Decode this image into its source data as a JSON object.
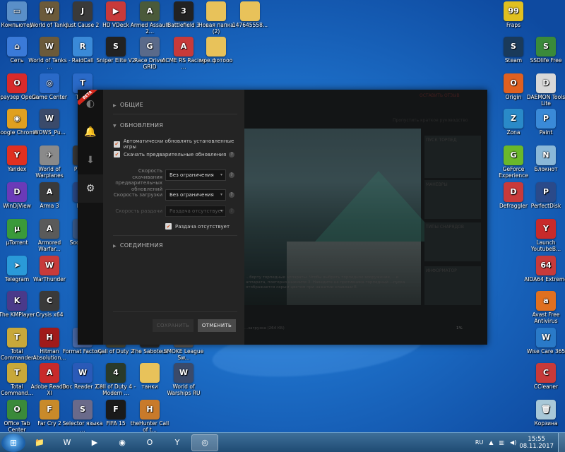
{
  "desktop": {
    "icons_left": [
      {
        "label": "Компьютер",
        "icon": "computer-icon",
        "color": "#5a8fc8",
        "glyph": "▭"
      },
      {
        "label": "World of Tanks",
        "icon": "world-of-tanks-icon",
        "color": "#6b5a3a",
        "glyph": "W"
      },
      {
        "label": "Just Cause 2",
        "icon": "just-cause-icon",
        "color": "#3a3a3a",
        "glyph": "J"
      },
      {
        "label": "HD VDeck",
        "icon": "hd-vdeck-icon",
        "color": "#c83a3a",
        "glyph": "▶"
      },
      {
        "label": "Armed Assault 2...",
        "icon": "armed-assault-icon",
        "color": "#4a5a3a",
        "glyph": "A"
      },
      {
        "label": "Battlefield 3",
        "icon": "battlefield-icon",
        "color": "#222",
        "glyph": "3"
      },
      {
        "label": "Новая папка (2)",
        "icon": "folder-icon",
        "color": "#e8c25a",
        "glyph": ""
      },
      {
        "label": "147645558...",
        "icon": "folder-icon",
        "color": "#e8c25a",
        "glyph": ""
      },
      {
        "label": "Сеть",
        "icon": "network-icon",
        "color": "#3a7ad8",
        "glyph": "⌂"
      },
      {
        "label": "World of Tanks - ...",
        "icon": "world-of-tanks-icon",
        "color": "#6b5a3a",
        "glyph": "W"
      },
      {
        "label": "RaidCall",
        "icon": "raidcall-icon",
        "color": "#3a8ad8",
        "glyph": "R"
      },
      {
        "label": "Sniper Elite V2",
        "icon": "sniper-elite-icon",
        "color": "#222",
        "glyph": "S"
      },
      {
        "label": "Race Driver GRID",
        "icon": "grid-icon",
        "color": "#5a6a8a",
        "glyph": "G"
      },
      {
        "label": "ACME RS Racing ...",
        "icon": "acme-icon",
        "color": "#c83a3a",
        "glyph": "A"
      },
      {
        "label": "мое.фотооо",
        "icon": "folder-icon",
        "color": "#e8c25a",
        "glyph": ""
      },
      {
        "label": "Браузер Opera",
        "icon": "opera-icon",
        "color": "#d82a2a",
        "glyph": "O"
      },
      {
        "label": "Game Center",
        "icon": "game-center-icon",
        "color": "#2a6ac8",
        "glyph": "◎"
      },
      {
        "label": "Team",
        "icon": "team-icon",
        "color": "#2a6ac8",
        "glyph": "T"
      },
      {
        "label": "Google Chrome",
        "icon": "chrome-icon",
        "color": "#e0a020",
        "glyph": "◉"
      },
      {
        "label": "WOWS_Pu...",
        "icon": "wows-icon",
        "color": "#3a4a6a",
        "glyph": "W"
      },
      {
        "label": "Yandex",
        "icon": "yandex-icon",
        "color": "#e03020",
        "glyph": "Y"
      },
      {
        "label": "World of Warplanes",
        "icon": "world-of-warplanes-icon",
        "color": "#8a8a8a",
        "glyph": "✈"
      },
      {
        "label": "PLANE",
        "icon": "plane-icon",
        "color": "#3a3a3a",
        "glyph": "P"
      },
      {
        "label": "WinDjView",
        "icon": "windjview-icon",
        "color": "#6a3ab8",
        "glyph": "D"
      },
      {
        "label": "Arma 3",
        "icon": "arma-icon",
        "color": "#3a3a3a",
        "glyph": "A"
      },
      {
        "label": "Blue",
        "icon": "blue-icon",
        "color": "#2a4a8a",
        "glyph": "B"
      },
      {
        "label": "µTorrent",
        "icon": "utorrent-icon",
        "color": "#3a9a3a",
        "glyph": "µ"
      },
      {
        "label": "Armored Warfar...",
        "icon": "armored-warfare-icon",
        "color": "#5a5a5a",
        "glyph": "A"
      },
      {
        "label": "Soci Lat...",
        "icon": "soci-icon",
        "color": "#3a5a8a",
        "glyph": "S"
      },
      {
        "label": "Telegram",
        "icon": "telegram-icon",
        "color": "#2a9ad8",
        "glyph": "➤"
      },
      {
        "label": "WarThunder",
        "icon": "warthunder-icon",
        "color": "#c83a3a",
        "glyph": "W"
      },
      {
        "label": "The KMPlayer",
        "icon": "kmplayer-icon",
        "color": "#4a3a8a",
        "glyph": "K"
      },
      {
        "label": "Crysis x64",
        "icon": "crysis-icon",
        "color": "#3a3a3a",
        "glyph": "C"
      },
      {
        "label": "Total Commander",
        "icon": "total-commander-icon",
        "color": "#c8a83a",
        "glyph": "T"
      },
      {
        "label": "Hitman Absolution...",
        "icon": "hitman-icon",
        "color": "#a01a1a",
        "glyph": "H"
      },
      {
        "label": "Format Factory",
        "icon": "format-factory-icon",
        "color": "#4a6aa8",
        "glyph": "F"
      },
      {
        "label": "Call of Duty 2",
        "icon": "cod2-icon",
        "color": "#4a4a3a",
        "glyph": "2"
      },
      {
        "label": "The Saboteur",
        "icon": "saboteur-icon",
        "color": "#2a2a2a",
        "glyph": "S"
      },
      {
        "label": "SMOKE League Sw...",
        "icon": "smoke-icon",
        "color": "#5a5a5a",
        "glyph": "S"
      },
      {
        "label": "Total Command...",
        "icon": "total-commander-icon",
        "color": "#c8a83a",
        "glyph": "T"
      },
      {
        "label": "Adobe Reader XI",
        "icon": "adobe-reader-icon",
        "color": "#c82a2a",
        "glyph": "A"
      },
      {
        "label": "Doc Reader 2.0",
        "icon": "doc-reader-icon",
        "color": "#2a5ab8",
        "glyph": "W"
      },
      {
        "label": "Call of Duty 4 - Modern ...",
        "icon": "cod4-icon",
        "color": "#2a3a2a",
        "glyph": "4"
      },
      {
        "label": "танки",
        "icon": "folder-icon",
        "color": "#e8c25a",
        "glyph": ""
      },
      {
        "label": "World of Warships RU",
        "icon": "world-of-warships-icon",
        "color": "#3a4a6a",
        "glyph": "W"
      },
      {
        "label": "Office Tab Center",
        "icon": "office-tab-icon",
        "color": "#3a8a3a",
        "glyph": "O"
      },
      {
        "label": "Far Cry 2",
        "icon": "farcry-icon",
        "color": "#c88a2a",
        "glyph": "F"
      },
      {
        "label": "Selector языка ...",
        "icon": "selector-icon",
        "color": "#6a6a8a",
        "glyph": "S"
      },
      {
        "label": "FIFA 15",
        "icon": "fifa-icon",
        "color": "#1a1a1a",
        "glyph": "F"
      },
      {
        "label": "theHunter Call of t...",
        "icon": "thehunter-icon",
        "color": "#c87a2a",
        "glyph": "H"
      }
    ],
    "icons_right": [
      {
        "label": "Fraps",
        "icon": "fraps-icon",
        "color": "#e0c020",
        "glyph": "99"
      },
      {
        "label": "Steam",
        "icon": "steam-icon",
        "color": "#1a3a5a",
        "glyph": "S"
      },
      {
        "label": "SSDlife Free",
        "icon": "ssdlife-icon",
        "color": "#3a8a3a",
        "glyph": "S"
      },
      {
        "label": "Origin",
        "icon": "origin-icon",
        "color": "#e06020",
        "glyph": "O"
      },
      {
        "label": "DAEMON Tools Lite",
        "icon": "daemon-tools-icon",
        "color": "#d8d8d8",
        "glyph": "D"
      },
      {
        "label": "Zona",
        "icon": "zona-icon",
        "color": "#2a8ac8",
        "glyph": "Z"
      },
      {
        "label": "Paint",
        "icon": "paint-icon",
        "color": "#3a8ad8",
        "glyph": "P"
      },
      {
        "label": "GeForce Experience",
        "icon": "geforce-icon",
        "color": "#6ab82a",
        "glyph": "G"
      },
      {
        "label": "Блокнот",
        "icon": "notepad-icon",
        "color": "#8ab8d8",
        "glyph": "N"
      },
      {
        "label": "Defraggler",
        "icon": "defraggler-icon",
        "color": "#c83a3a",
        "glyph": "D"
      },
      {
        "label": "PerfectDisk",
        "icon": "perfectdisk-icon",
        "color": "#2a4a8a",
        "glyph": "P"
      },
      {
        "label": "Launch YoutubeB...",
        "icon": "youtube-icon",
        "color": "#c82a2a",
        "glyph": "Y"
      },
      {
        "label": "AIDA64 Extreme",
        "icon": "aida64-icon",
        "color": "#c83a3a",
        "glyph": "64"
      },
      {
        "label": "Avast Free Antivirus",
        "icon": "avast-icon",
        "color": "#e07020",
        "glyph": "a"
      },
      {
        "label": "Wise Care 365",
        "icon": "wise-care-icon",
        "color": "#2a7ac8",
        "glyph": "W"
      },
      {
        "label": "CCleaner",
        "icon": "ccleaner-icon",
        "color": "#c83a3a",
        "glyph": "C"
      },
      {
        "label": "Корзина",
        "icon": "recycle-bin-icon",
        "color": "#a8c8d8",
        "glyph": "🗑"
      }
    ]
  },
  "app": {
    "beta_label": "BETA",
    "rail": [
      {
        "name": "rail-logo",
        "icon": "app-logo-icon",
        "glyph": "◐"
      },
      {
        "name": "rail-notifications",
        "icon": "bell-icon",
        "glyph": "🔔"
      },
      {
        "name": "rail-downloads",
        "icon": "download-icon",
        "glyph": "⬇"
      },
      {
        "name": "rail-settings",
        "icon": "gear-icon",
        "glyph": "⚙"
      }
    ],
    "settings": {
      "general_label": "ОБЩИЕ",
      "updates_label": "ОБНОВЛЕНИЯ",
      "auto_update_label": "Автоматически обновлять установленные игры",
      "preload_label": "Скачать предварительные обновления",
      "download_speed_label": "Скорость скачивания предварительных обновлений",
      "download_speed_value": "Без ограничения",
      "upload_speed_label": "Скорость загрузки",
      "upload_speed_value": "Без ограничения",
      "seed_speed_label": "Скорость раздачи",
      "seed_speed_value": "Раздача отсутствует",
      "no_seeding_label": "Раздача отсутствует",
      "connections_label": "СОЕДИНЕНИЯ",
      "save_label": "СОХРАНИТЬ",
      "cancel_label": "ОТМЕНИТЬ"
    },
    "game_panel": {
      "feedback_label": "ОСТАВИТЬ ОТЗЫВ",
      "skip_guide_label": "Пропустить краткое руководство",
      "side_items": [
        "ПУСК ТОРПЕД",
        "МАНЕВРЫ",
        "ТИПЫ СНАРЯДОВ",
        "ИНФОРМАТОР"
      ],
      "hint_text": "...борту торпедные аппараты. Чтобы выбрать торпедное вооружение, ...е аппарата, повторно нажмите 3. Наведите на противника торпедный ...пуска отображается серым цветом при нажатии клавиши Е.",
      "progress_text": "1%",
      "status_text": "...загрузка (264 КБ)"
    }
  },
  "taskbar": {
    "items": [
      {
        "name": "taskbar-explorer",
        "icon": "folder-icon",
        "glyph": "📁"
      },
      {
        "name": "taskbar-world-of-tanks",
        "icon": "world-of-tanks-icon",
        "glyph": "W"
      },
      {
        "name": "taskbar-media",
        "icon": "media-player-icon",
        "glyph": "▶"
      },
      {
        "name": "taskbar-chrome",
        "icon": "chrome-icon",
        "glyph": "◉"
      },
      {
        "name": "taskbar-opera",
        "icon": "opera-icon",
        "glyph": "O"
      },
      {
        "name": "taskbar-yandex",
        "icon": "yandex-icon",
        "glyph": "Y"
      },
      {
        "name": "taskbar-game-center",
        "icon": "game-center-icon",
        "glyph": "◎"
      }
    ],
    "lang": "RU",
    "time": "15:55",
    "date": "08.11.2017"
  }
}
